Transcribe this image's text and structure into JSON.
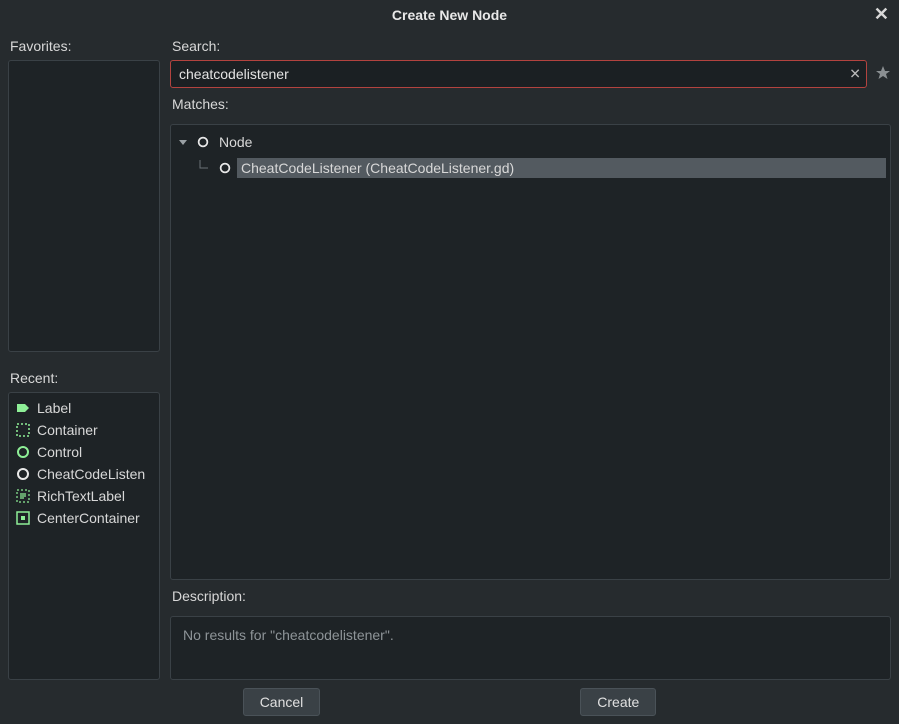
{
  "dialog": {
    "title": "Create New Node"
  },
  "labels": {
    "favorites": "Favorites:",
    "recent": "Recent:",
    "search": "Search:",
    "matches": "Matches:",
    "description": "Description:"
  },
  "search": {
    "value": "cheatcodelistener",
    "clear_glyph": "✕"
  },
  "tree": {
    "root": "Node",
    "child": "CheatCodeListener (CheatCodeListener.gd)"
  },
  "description": {
    "text": "No results for \"cheatcodelistener\"."
  },
  "recent": [
    {
      "name": "Label",
      "icon": "label"
    },
    {
      "name": "Container",
      "icon": "container"
    },
    {
      "name": "Control",
      "icon": "control"
    },
    {
      "name": "CheatCodeListen",
      "icon": "node-white"
    },
    {
      "name": "RichTextLabel",
      "icon": "richtext"
    },
    {
      "name": "CenterContainer",
      "icon": "center"
    }
  ],
  "buttons": {
    "cancel": "Cancel",
    "create": "Create"
  },
  "colors": {
    "green": "#8eef97",
    "white": "#e8e8e8"
  }
}
